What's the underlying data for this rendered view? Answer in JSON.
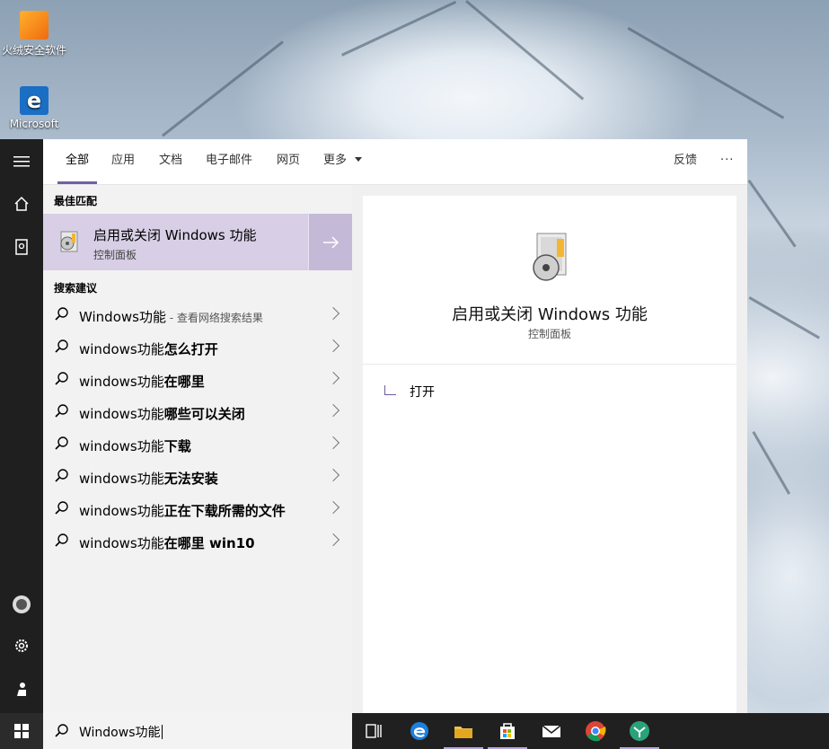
{
  "desktop": {
    "icons": [
      {
        "label": "火绒安全软件",
        "icon": "huorong-shield-icon"
      },
      {
        "label": "Microsoft",
        "icon": "edge-icon"
      }
    ]
  },
  "rail": {
    "icons": [
      "hamburger-menu-icon",
      "home-icon",
      "notebook-icon",
      "user-avatar-icon",
      "gear-icon",
      "feedback-person-icon"
    ]
  },
  "tabs": {
    "items": [
      "全部",
      "应用",
      "文档",
      "电子邮件",
      "网页",
      "更多"
    ],
    "active": "全部",
    "feedback": "反馈",
    "more_options": "···"
  },
  "results": {
    "best_match_header": "最佳匹配",
    "best_match": {
      "title": "启用或关闭 Windows 功能",
      "subtitle": "控制面板"
    },
    "suggestions_header": "搜索建议",
    "suggestions": [
      {
        "prefix": "Windows功能",
        "bold": "",
        "hint": " - 查看网络搜索结果"
      },
      {
        "prefix": "windows功能",
        "bold": "怎么打开",
        "hint": ""
      },
      {
        "prefix": "windows功能",
        "bold": "在哪里",
        "hint": ""
      },
      {
        "prefix": "windows功能",
        "bold": "哪些可以关闭",
        "hint": ""
      },
      {
        "prefix": "windows功能",
        "bold": "下载",
        "hint": ""
      },
      {
        "prefix": "windows功能",
        "bold": "无法安装",
        "hint": ""
      },
      {
        "prefix": "windows功能",
        "bold": "正在下载所需的文件",
        "hint": ""
      },
      {
        "prefix": "windows功能",
        "bold": "在哪里 win10",
        "hint": ""
      }
    ]
  },
  "preview": {
    "title": "启用或关闭 Windows 功能",
    "subtitle": "控制面板",
    "actions": [
      {
        "label": "打开",
        "icon": "open-external-icon"
      }
    ]
  },
  "taskbar": {
    "search_value": "Windows功能",
    "apps": [
      "task-view-icon",
      "edge-icon",
      "file-explorer-icon",
      "store-icon",
      "mail-icon",
      "chrome-icon",
      "app-icon"
    ]
  },
  "colors": {
    "accent": "#7160a4",
    "selected": "#d8cfe6",
    "taskbar": "#202020"
  }
}
